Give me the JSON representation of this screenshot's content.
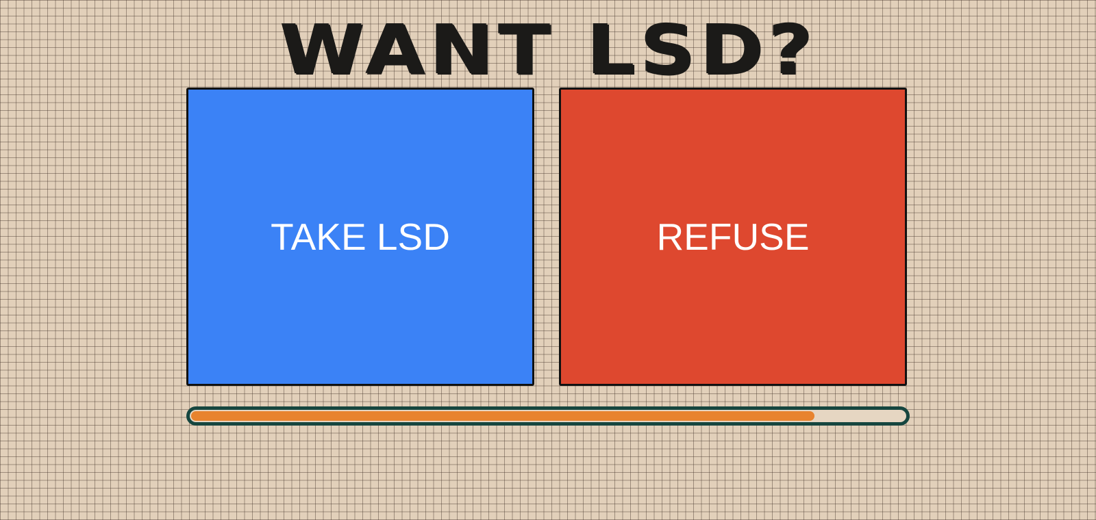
{
  "title": "WANT LSD?",
  "buttons": {
    "take": {
      "label": "TAKE LSD",
      "color": "#3b82f6"
    },
    "refuse": {
      "label": "REFUSE",
      "color": "#de482f"
    }
  },
  "progress": {
    "fraction": 0.873,
    "fill_color": "#e8832e",
    "track_border_color": "#16463f"
  },
  "background_color": "#e2d0ba"
}
